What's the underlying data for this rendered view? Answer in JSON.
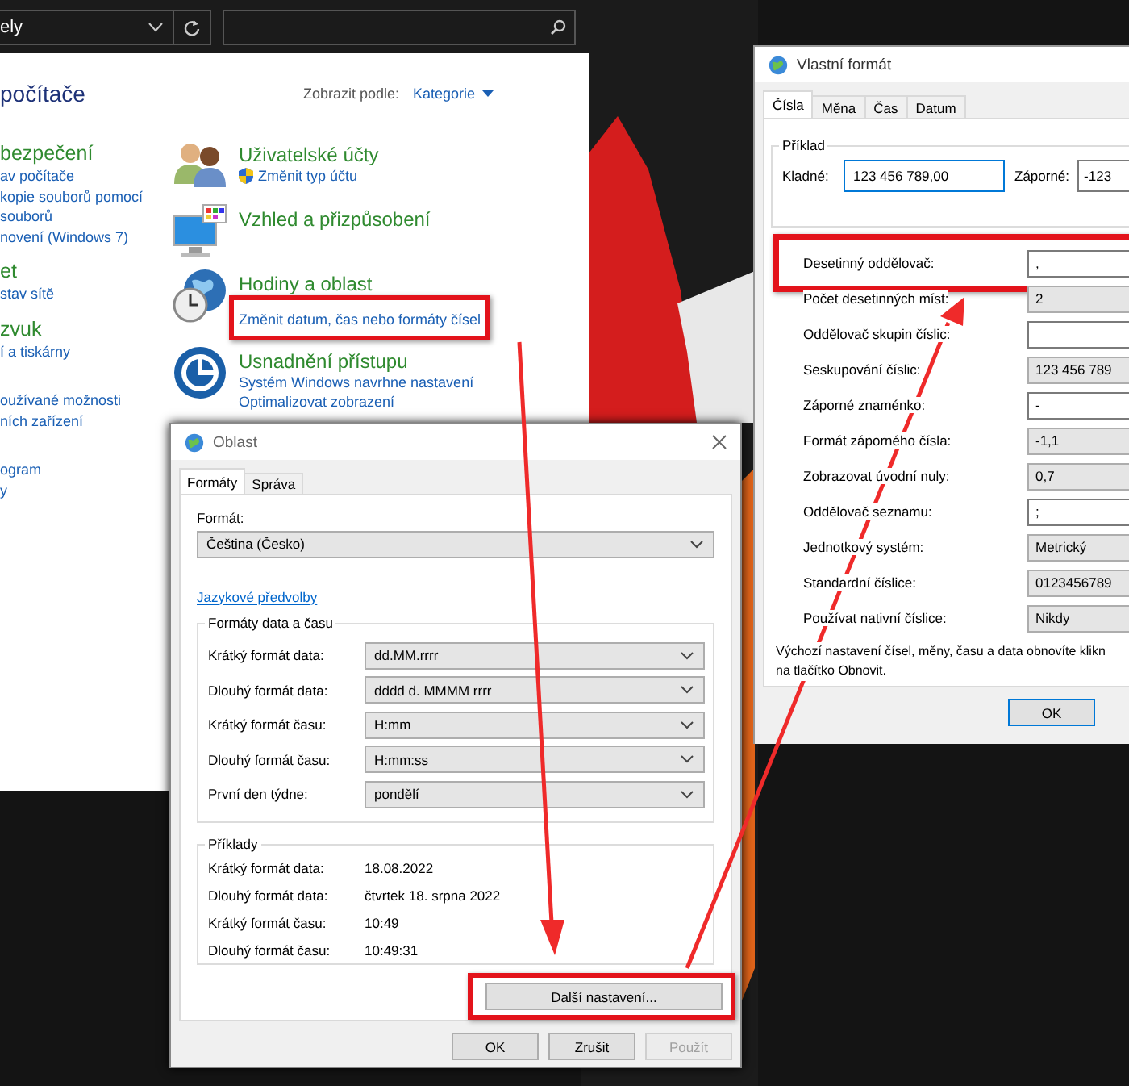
{
  "control_panel": {
    "address": "ely",
    "heading": "počítače",
    "view_by_label": "Zobrazit podle:",
    "view_by_value": "Kategorie",
    "left_categories": [
      {
        "title": "bezpečení",
        "links": [
          "av počítače",
          "kopie souborů pomocí",
          "souborů",
          "novení (Windows 7)"
        ]
      },
      {
        "title": "et",
        "links": [
          "stav sítě"
        ]
      },
      {
        "title": "zvuk",
        "links": [
          "í a tiskárny"
        ]
      },
      {
        "links": [
          "oužívané možnosti",
          "ních zařízení"
        ]
      },
      {
        "links": [
          "ogram",
          "y"
        ]
      }
    ],
    "categories": [
      {
        "title": "Uživatelské účty",
        "links": [
          {
            "text": "Změnit typ účtu",
            "shield": true,
            "highlighted": false
          }
        ]
      },
      {
        "title": "Vzhled a přizpůsobení"
      },
      {
        "title": "Hodiny a oblast",
        "links": [
          {
            "text": "Změnit datum, čas nebo formáty čísel",
            "shield": false,
            "highlighted": true
          }
        ]
      },
      {
        "title": "Usnadnění přístupu",
        "links": [
          {
            "text": "Systém Windows navrhne nastavení",
            "shield": false,
            "highlighted": false
          },
          {
            "text": "Optimalizovat zobrazení",
            "shield": false,
            "highlighted": false
          }
        ]
      }
    ]
  },
  "region_dialog": {
    "title": "Oblast",
    "tabs": [
      {
        "label": "Formáty",
        "selected": true
      },
      {
        "label": "Správa",
        "selected": false
      }
    ],
    "format_label": "Formát:",
    "format_value": "Čeština (Česko)",
    "language_link": "Jazykové předvolby",
    "date_time_group": {
      "title": "Formáty data a času",
      "rows": [
        {
          "label": "Krátký formát data:",
          "value": "dd.MM.rrrr"
        },
        {
          "label": "Dlouhý formát data:",
          "value": "dddd d. MMMM rrrr"
        },
        {
          "label": "Krátký formát času:",
          "value": "H:mm"
        },
        {
          "label": "Dlouhý formát času:",
          "value": "H:mm:ss"
        },
        {
          "label": "První den týdne:",
          "value": "pondělí"
        }
      ]
    },
    "examples": {
      "title": "Příklady",
      "rows": [
        {
          "label": "Krátký formát data:",
          "value": "18.08.2022"
        },
        {
          "label": "Dlouhý formát data:",
          "value": "čtvrtek 18. srpna 2022"
        },
        {
          "label": "Krátký formát času:",
          "value": "10:49"
        },
        {
          "label": "Dlouhý formát času:",
          "value": "10:49:31"
        }
      ]
    },
    "more_button": {
      "label": "Další nastavení...",
      "highlighted": true
    },
    "buttons": [
      {
        "label": "OK",
        "disabled": false
      },
      {
        "label": "Zrušit",
        "disabled": false
      },
      {
        "label": "Použít",
        "disabled": true
      }
    ]
  },
  "custom_dialog": {
    "title": "Vlastní formát",
    "tabs": [
      {
        "label": "Čísla",
        "selected": true
      },
      {
        "label": "Měna",
        "selected": false
      },
      {
        "label": "Čas",
        "selected": false
      },
      {
        "label": "Datum",
        "selected": false
      }
    ],
    "example": {
      "title": "Příklad",
      "positive_label": "Kladné:",
      "positive_value": "123 456 789,00",
      "negative_label": "Záporné:",
      "negative_value": "-123"
    },
    "rows": [
      {
        "label": "Desetinný oddělovač:",
        "value": ",",
        "kind": "text",
        "highlighted": true
      },
      {
        "label": "Počet desetinných míst:",
        "value": "2",
        "kind": "combo",
        "highlighted": false
      },
      {
        "label": "Oddělovač skupin číslic:",
        "kind": "text",
        "highlighted": false
      },
      {
        "label": "Seskupování číslic:",
        "value": "123 456 789",
        "kind": "combo",
        "highlighted": false
      },
      {
        "label": "Záporné znaménko:",
        "value": "-",
        "kind": "text",
        "highlighted": false
      },
      {
        "label": "Formát záporného čísla:",
        "value": "-1,1",
        "kind": "combo",
        "highlighted": false
      },
      {
        "label": "Zobrazovat úvodní nuly:",
        "value": "0,7",
        "kind": "combo",
        "highlighted": false
      },
      {
        "label": "Oddělovač seznamu:",
        "value": ";",
        "kind": "text",
        "highlighted": false
      },
      {
        "label": "Jednotkový systém:",
        "value": "Metrický",
        "kind": "combo",
        "highlighted": false
      },
      {
        "label": "Standardní číslice:",
        "value": "0123456789",
        "kind": "combo",
        "highlighted": false
      },
      {
        "label": "Používat nativní číslice:",
        "value": "Nikdy",
        "kind": "combo",
        "highlighted": false
      }
    ],
    "note_lines": [
      "Výchozí nastavení čísel, měny, času a data obnovíte klikn",
      "na tlačítko Obnovit."
    ],
    "buttons": [
      {
        "label": "OK",
        "default": true
      }
    ]
  }
}
